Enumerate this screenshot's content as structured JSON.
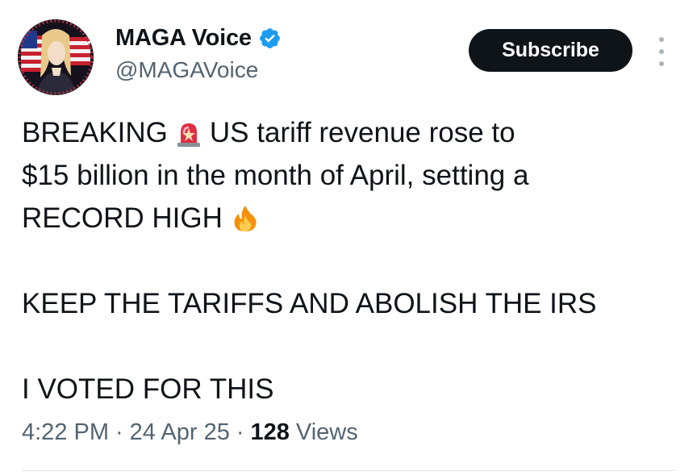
{
  "author": {
    "display_name": "MAGA Voice",
    "handle": "@MAGAVoice",
    "verified": true,
    "avatar_icon": "patriotic-portrait-avatar"
  },
  "actions": {
    "subscribe_label": "Subscribe",
    "more_icon": "more-options-icon"
  },
  "tweet": {
    "line1_before": "BREAKING",
    "line1_emoji": "police-light-emoji",
    "line1_after": "US tariff revenue rose to",
    "line2": "$15 billion in the month of April, setting a",
    "line3": "RECORD HIGH",
    "line3_emoji": "fire-emoji",
    "line4": "KEEP THE TARIFFS AND ABOLISH THE IRS",
    "line5": "I VOTED FOR THIS"
  },
  "meta": {
    "time": "4:22 PM",
    "date": "24 Apr 25",
    "views_count": "128",
    "views_label": "Views",
    "separator": "·"
  },
  "colors": {
    "text": "#0f1419",
    "secondary": "#536471",
    "verified_blue": "#1d9bf0",
    "button_bg": "#0f1419",
    "divider": "#dbe3e8"
  }
}
